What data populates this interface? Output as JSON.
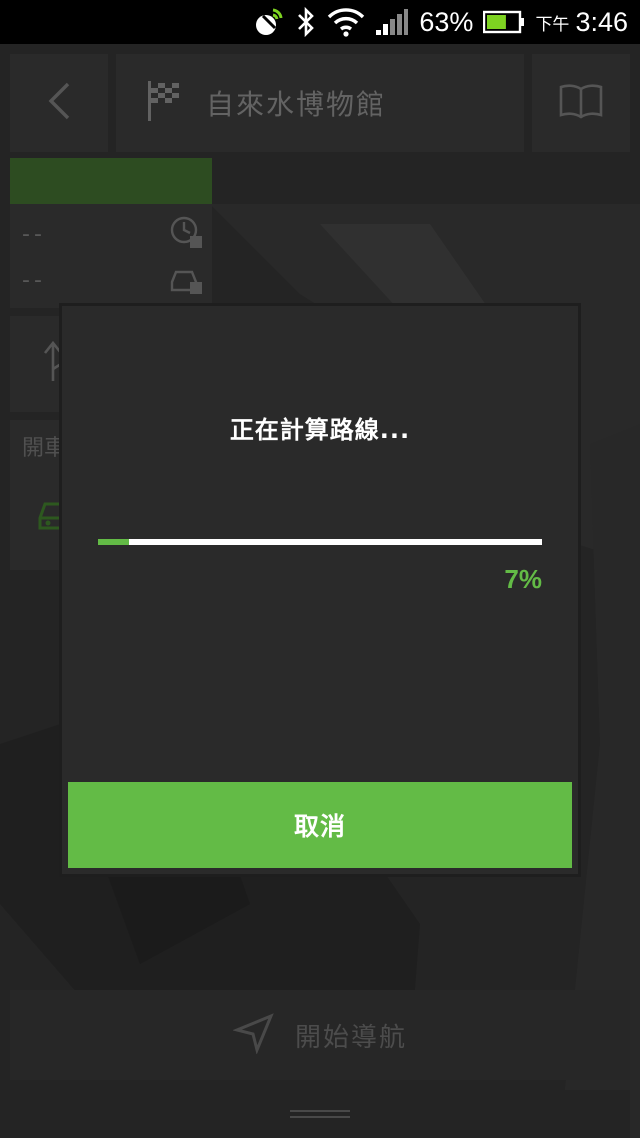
{
  "status_bar": {
    "icons": [
      "gps-satellite-icon",
      "bluetooth-icon",
      "wifi-icon",
      "signal-icon",
      "battery-icon"
    ],
    "battery_percent": "63%",
    "battery_level": 0.63,
    "ampm": "下午",
    "time": "3:46"
  },
  "header": {
    "back_icon": "chevron-left-icon",
    "destination_icon": "checkered-flag-icon",
    "destination_name": "自來水博物館",
    "book_icon": "book-icon"
  },
  "route_info": {
    "time_value": "--",
    "distance_value": "--",
    "time_icon": "clock-icon",
    "distance_icon": "car-distance-icon"
  },
  "controls": {
    "route_icon": "route-icon",
    "settings_icon": "gears-icon"
  },
  "mode": {
    "label": "開車",
    "car_icon": "car-icon",
    "walk_icon": "pedestrian-icon"
  },
  "start_navigation": {
    "label": "開始導航",
    "icon": "navigation-arrow-icon"
  },
  "dialog": {
    "title": "正在計算路線...",
    "progress_value": 0.07,
    "progress_text": "7%",
    "cancel_label": "取消"
  },
  "colors": {
    "accent_green": "#63bb46",
    "dialog_bg": "#2a2a2a",
    "tile_bg": "#3b3b3b"
  }
}
